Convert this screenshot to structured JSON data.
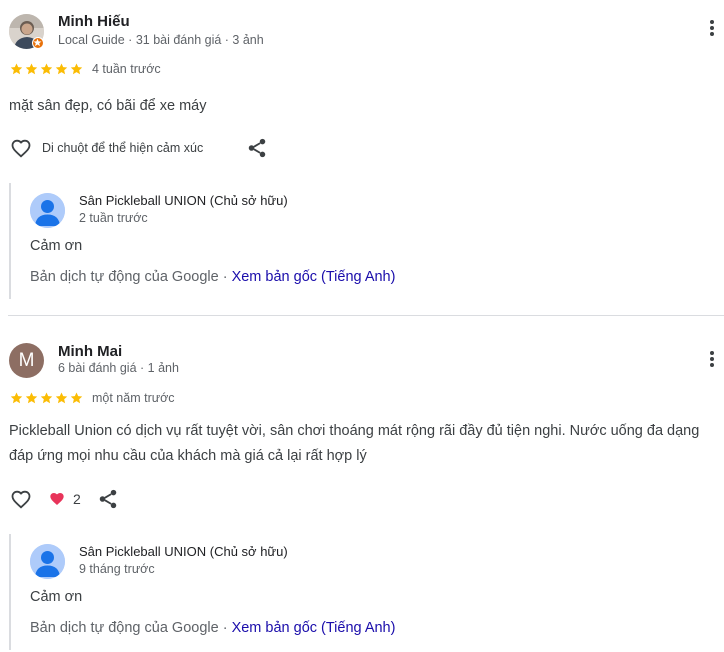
{
  "reviews": [
    {
      "name": "Minh Hiếu",
      "meta": "Local Guide · 31 bài đánh giá · 3 ảnh",
      "rating": 5,
      "time": "4 tuần trước",
      "text": "mặt sân đẹp, có bãi để xe máy",
      "hover_hint": "Di chuột để thể hiện cảm xúc",
      "owner_reply": {
        "name": "Sân Pickleball UNION (Chủ sở hữu)",
        "time": "2 tuần trước",
        "text": "Cảm ơn",
        "translation_prefix": "Bản dịch tự động của Google · ",
        "view_original": "Xem bản gốc (Tiếng Anh)"
      }
    },
    {
      "name": "Minh Mai",
      "avatar_letter": "M",
      "meta": "6 bài đánh giá · 1 ảnh",
      "rating": 5,
      "time": "một năm trước",
      "text": "Pickleball Union có dịch vụ rất tuyệt vời, sân chơi thoáng mát rộng rãi đầy đủ tiện nghi. Nước uống đa dạng đáp ứng mọi nhu cầu của khách mà giá cả lại rất hợp lý",
      "reaction_count": "2",
      "owner_reply": {
        "name": "Sân Pickleball UNION (Chủ sở hữu)",
        "time": "9 tháng trước",
        "text": "Cảm ơn",
        "translation_prefix": "Bản dịch tự động của Google · ",
        "view_original": "Xem bản gốc (Tiếng Anh)"
      }
    }
  ],
  "icons": {
    "star": "star-icon",
    "like": "heart-outline-icon",
    "reaction": "heart-filled-icon",
    "share": "share-icon",
    "menu": "more-vert-icon",
    "owner_avatar": "default-person-icon",
    "guide_badge": "local-guide-star-icon"
  },
  "colors": {
    "star": "#fbbc04",
    "link": "#1a0dab",
    "reaction_heart": "#e8345a",
    "owner_avatar_bg": "#aecbfa",
    "avatar_letter_bg": "#8d6e63",
    "guide_badge": "#e8710a"
  }
}
